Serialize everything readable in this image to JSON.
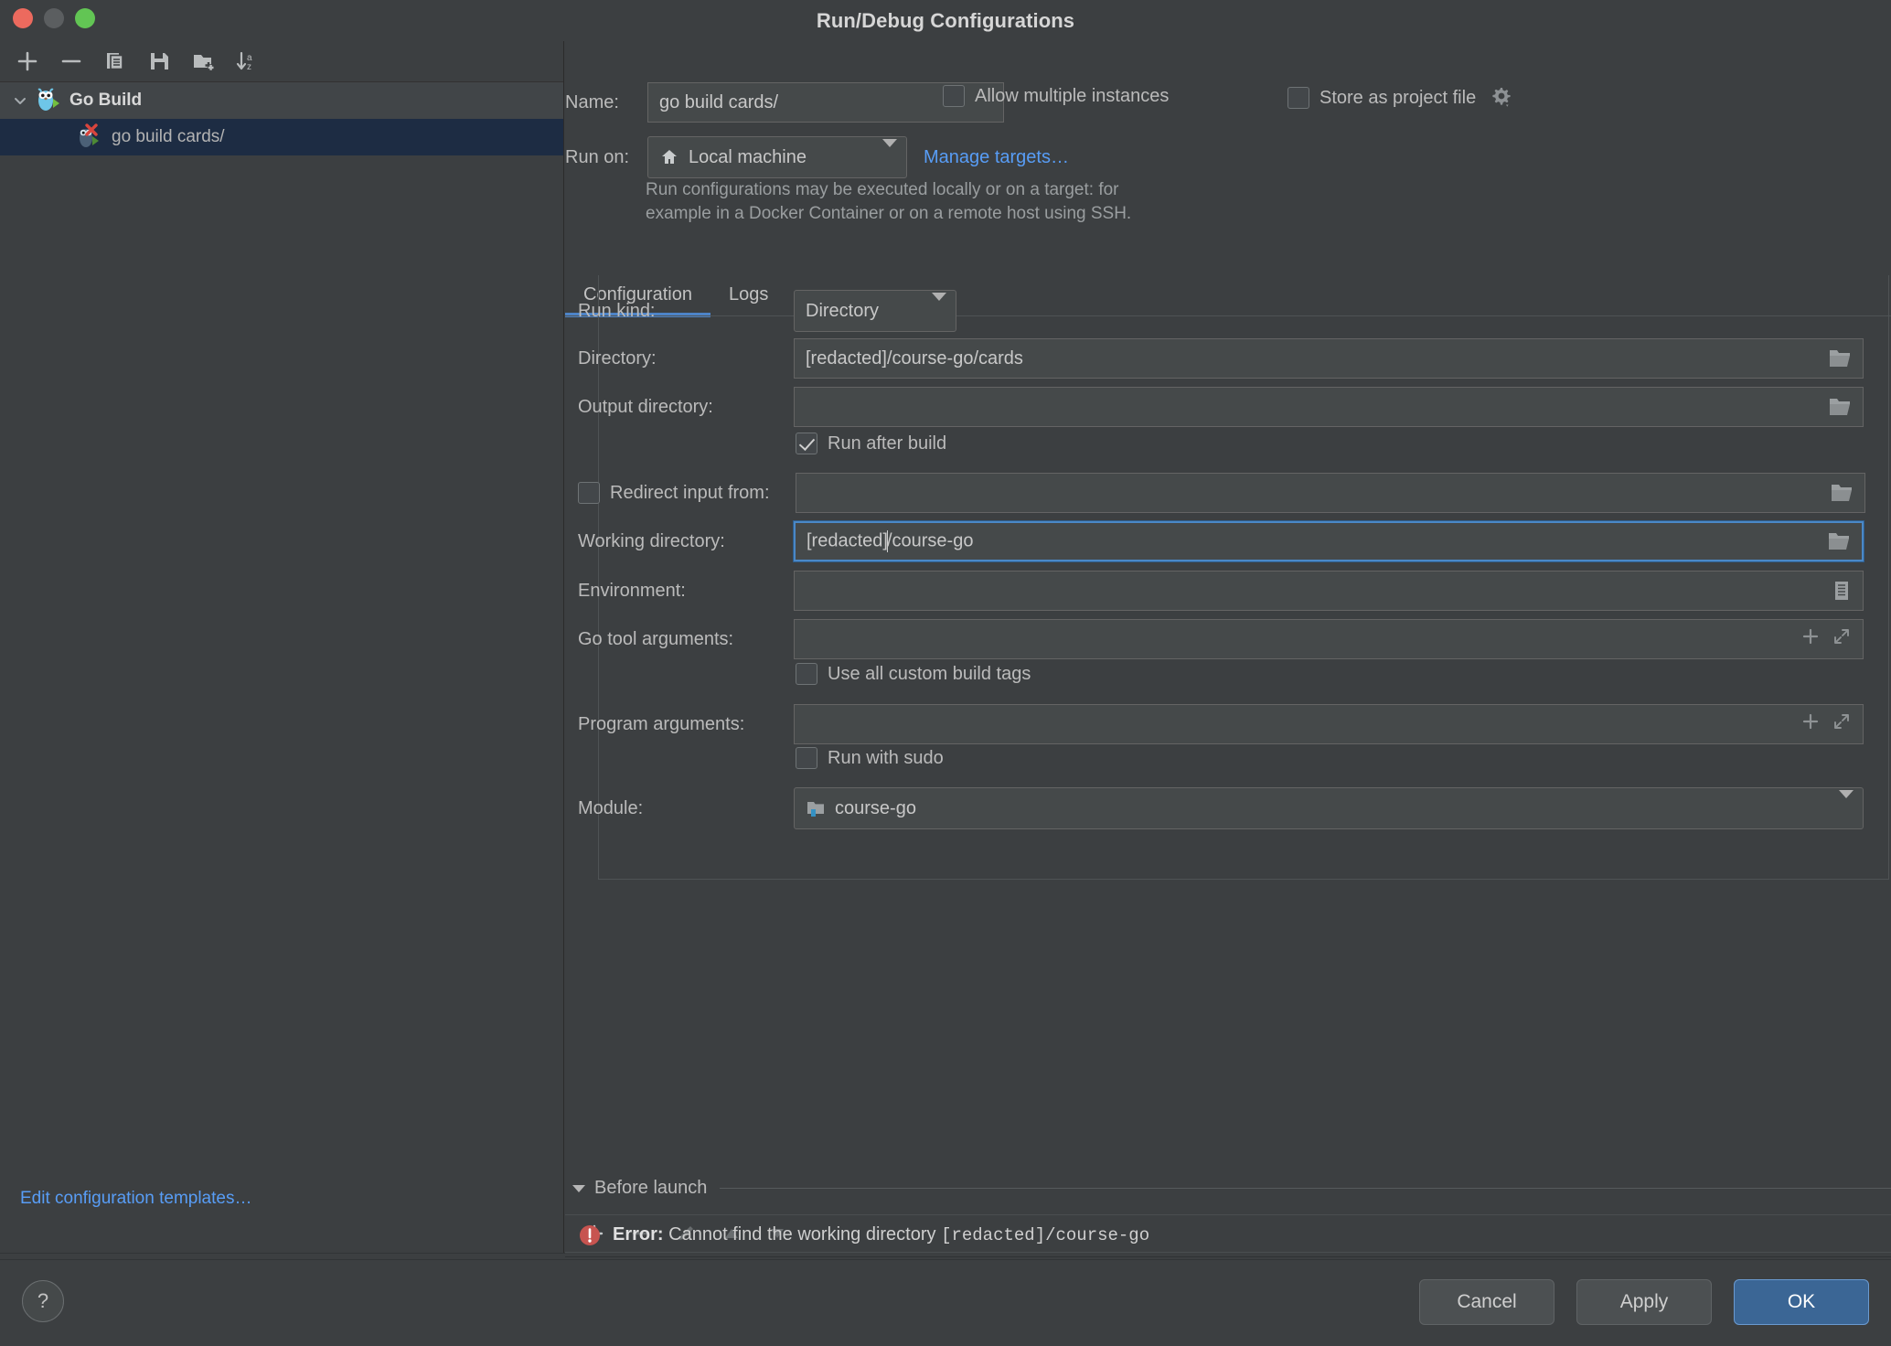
{
  "window": {
    "title": "Run/Debug Configurations",
    "traffic_lights": [
      "close",
      "minimize",
      "zoom"
    ]
  },
  "sidebar": {
    "toolbar": [
      {
        "name": "add-configuration-button",
        "icon": "plus-icon"
      },
      {
        "name": "remove-configuration-button",
        "icon": "minus-icon"
      },
      {
        "name": "copy-configuration-button",
        "icon": "copy-icon"
      },
      {
        "name": "save-configuration-button",
        "icon": "save-icon"
      },
      {
        "name": "new-folder-button",
        "icon": "new-folder-icon"
      },
      {
        "name": "sort-configurations-button",
        "icon": "sort-az-icon"
      }
    ],
    "tree": [
      {
        "label": "Go Build",
        "icon": "go-gopher-icon",
        "expanded": true,
        "selected": false
      },
      {
        "label": "go build cards/",
        "icon": "go-gopher-error-icon",
        "expanded": false,
        "selected": true
      }
    ],
    "edit_templates_link": "Edit configuration templates…"
  },
  "form": {
    "name_label": "Name:",
    "name_value": "go build cards/",
    "allow_multiple_instances": {
      "label": "Allow multiple instances",
      "checked": false
    },
    "store_as_project_file": {
      "label": "Store as project file",
      "checked": false,
      "gear_icon": "gear-dropdown-icon"
    },
    "run_on_label": "Run on:",
    "run_on_value": "Local machine",
    "run_on_icon": "home-icon",
    "manage_targets_link": "Manage targets…",
    "hint_line1": "Run configurations may be executed locally or on a target: for",
    "hint_line2": "example in a Docker Container or on a remote host using SSH."
  },
  "tabs": [
    {
      "label": "Configuration",
      "active": true
    },
    {
      "label": "Logs",
      "active": false
    }
  ],
  "configuration": {
    "run_kind_label": "Run kind:",
    "run_kind_value": "Directory",
    "directory_label": "Directory:",
    "directory_value": "[redacted]/course-go/cards",
    "output_directory_label": "Output directory:",
    "output_directory_value": "",
    "run_after_build": {
      "label": "Run after build",
      "checked": true
    },
    "redirect_input_from": {
      "label": "Redirect input from:",
      "checked": false,
      "value": ""
    },
    "working_directory_label": "Working directory:",
    "working_directory_value_before_caret": "[redacted]",
    "working_directory_value_after_caret": "/course-go",
    "environment_label": "Environment:",
    "environment_value": "",
    "go_tool_arguments_label": "Go tool arguments:",
    "go_tool_arguments_value": "",
    "use_all_custom_build_tags": {
      "label": "Use all custom build tags",
      "checked": false
    },
    "program_arguments_label": "Program arguments:",
    "program_arguments_value": "",
    "run_with_sudo": {
      "label": "Run with sudo",
      "checked": false
    },
    "module_label": "Module:",
    "module_value": "course-go",
    "module_icon": "module-folder-icon"
  },
  "before_launch": {
    "title": "Before launch",
    "expanded": true,
    "toolbar": [
      {
        "name": "add-task-button",
        "icon": "plus-icon",
        "enabled": true
      },
      {
        "name": "remove-task-button",
        "icon": "minus-icon",
        "enabled": false
      },
      {
        "name": "edit-task-button",
        "icon": "pencil-icon",
        "enabled": false
      },
      {
        "name": "move-task-up-button",
        "icon": "arrow-up-icon",
        "enabled": false
      },
      {
        "name": "move-task-down-button",
        "icon": "arrow-down-icon",
        "enabled": false
      }
    ]
  },
  "error": {
    "icon": "error-icon",
    "prefix": "Error:",
    "message": " Cannot find the working directory ",
    "path": "[redacted]/course-go"
  },
  "footer": {
    "help_label": "?",
    "cancel_label": "Cancel",
    "apply_label": "Apply",
    "ok_label": "OK"
  },
  "colors": {
    "accent_blue": "#4d84c8",
    "link_blue": "#589df6",
    "error_red": "#c75450",
    "selection_navy": "#1d2c43",
    "background": "#3c3f41",
    "field_background": "#45494a"
  }
}
